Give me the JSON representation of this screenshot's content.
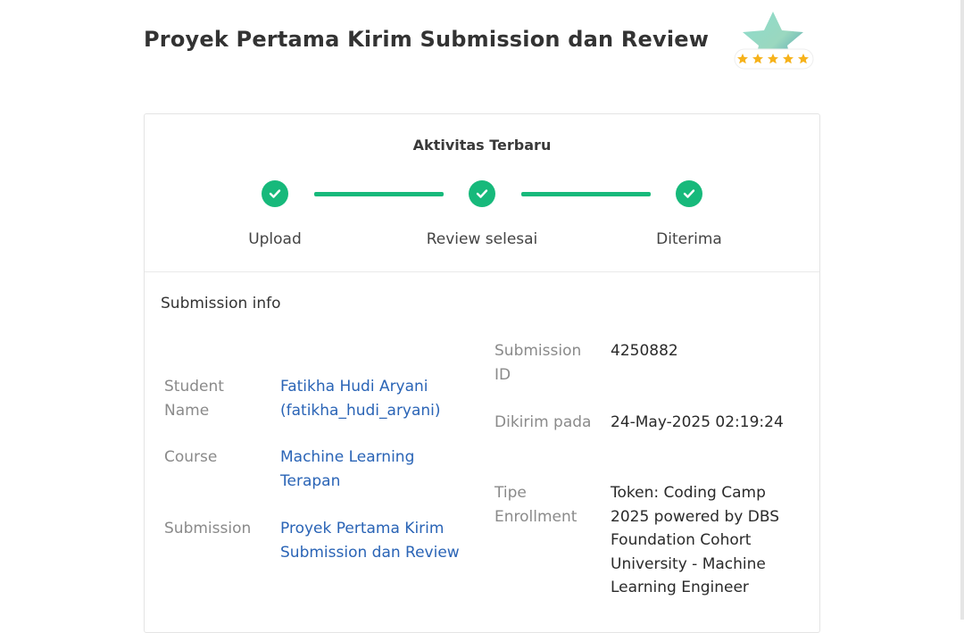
{
  "page": {
    "title": "Proyek Pertama Kirim Submission dan Review"
  },
  "badge": {
    "icon": "rating-star-badge-icon",
    "stars": 5
  },
  "activity": {
    "title": "Aktivitas Terbaru",
    "steps": [
      {
        "label": "Upload",
        "status": "done"
      },
      {
        "label": "Review selesai",
        "status": "done"
      },
      {
        "label": "Diterima",
        "status": "done"
      }
    ],
    "accent_color": "#17b97b"
  },
  "submission_info": {
    "title": "Submission info",
    "left": [
      {
        "label": "Student Name",
        "value": "Fatikha Hudi Aryani (fatikha_hudi_aryani)"
      },
      {
        "label": "Course",
        "value": "Machine Learning Terapan"
      },
      {
        "label": "Submission",
        "value": "Proyek Pertama Kirim Submission dan Review"
      }
    ],
    "right": [
      {
        "label": "Submission ID",
        "value": "4250882"
      },
      {
        "label": "Dikirim pada",
        "value": "24-May-2025 02:19:24"
      },
      {
        "label": "Tipe Enrollment",
        "value": "Token: Coding Camp 2025 powered by DBS Foundation Cohort University - Machine Learning Engineer"
      }
    ],
    "link_color": "#2a64b6"
  }
}
